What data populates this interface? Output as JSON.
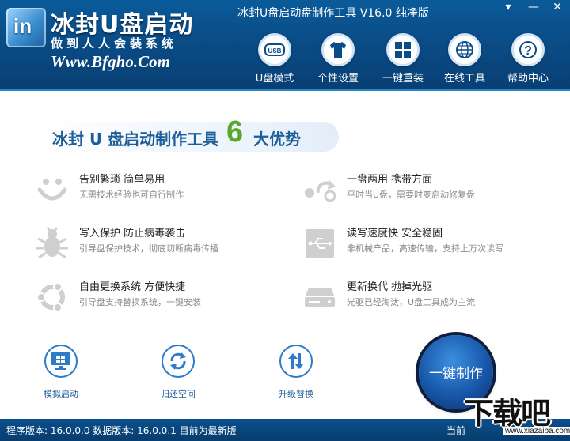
{
  "header": {
    "logo_mark": "in",
    "title": "冰封U盘启动",
    "slogan": "做到人人会装系统",
    "url": "Www.Bfgho.Com",
    "window_title": "冰封U盘启动盘制作工具 V16.0 纯净版",
    "win_controls": {
      "menu": "▾",
      "minimize": "—",
      "close": "✕"
    }
  },
  "nav": [
    {
      "label": "U盘模式",
      "icon": "usb-icon"
    },
    {
      "label": "个性设置",
      "icon": "tshirt-icon"
    },
    {
      "label": "一键重装",
      "icon": "windows-icon"
    },
    {
      "label": "在线工具",
      "icon": "globe-icon"
    },
    {
      "label": "帮助中心",
      "icon": "help-icon"
    }
  ],
  "headline": {
    "text": "冰封 U 盘启动制作工具",
    "number": "6",
    "suffix": "大优势"
  },
  "features": [
    {
      "title": "告别繁琐 简单易用",
      "desc": "无需技术经验也可自行制作",
      "icon": "smile-icon"
    },
    {
      "title": "一盘两用 携带方面",
      "desc": "平时当U盘，需要时变启动修复盘",
      "icon": "refresh-switch-icon"
    },
    {
      "title": "写入保护 防止病毒袭击",
      "desc": "引导盘保护技术，彻底切断病毒传播",
      "icon": "bug-icon"
    },
    {
      "title": "读写速度快 安全稳固",
      "desc": "非机械产品，高速传输，支持上万次读写",
      "icon": "usb-drive-icon"
    },
    {
      "title": "自由更换系统 方便快捷",
      "desc": "引导盘支持替换系统，一键安装",
      "icon": "ubuntu-icon"
    },
    {
      "title": "更新换代 抛掉光驱",
      "desc": "光驱已经淘汰，U盘工具成为主流",
      "icon": "disk-drive-icon"
    }
  ],
  "tools": [
    {
      "label": "模拟启动",
      "icon": "monitor-windows-icon"
    },
    {
      "label": "归还空间",
      "icon": "restore-icon"
    },
    {
      "label": "升级替换",
      "icon": "upgrade-icon"
    }
  ],
  "main_button": "一键制作",
  "status": {
    "text": "程序版本: 16.0.0.0 数据版本: 16.0.0.1 目前为最新版",
    "right": "当前"
  },
  "watermark": {
    "text": "下载吧",
    "url": "www.xiazaiba.com"
  },
  "colors": {
    "header": "#0a4c86",
    "accent": "#1d5e9a",
    "green": "#5ba72d"
  }
}
